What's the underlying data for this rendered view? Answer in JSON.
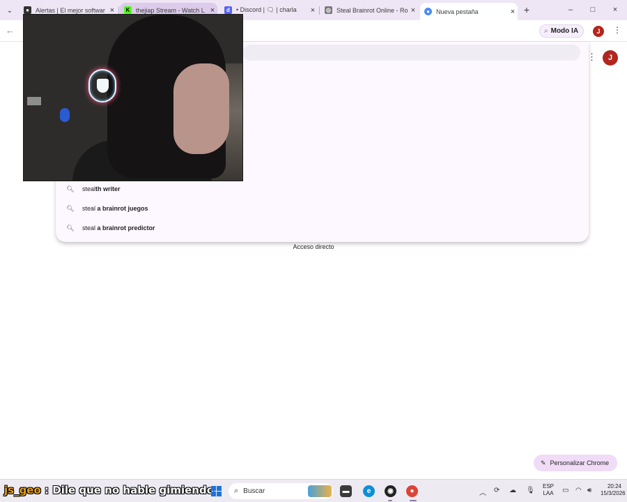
{
  "colors": {
    "accent": "#7b5ca3",
    "tab_strip_bg": "#efe6f5",
    "dropdown_bg": "#fdf7ff",
    "avatar": "#b3261e",
    "chat_username": "#e2a11d"
  },
  "browser": {
    "tabs": [
      {
        "favicon": "obs-icon",
        "title": "Alertas | El mejor softwar",
        "close": "×"
      },
      {
        "favicon": "kick-icon",
        "title": "thejiap Stream - Watch L",
        "close": "×"
      },
      {
        "favicon": "discord-icon",
        "title": "• Discord | 🗨 | charla",
        "close": "×"
      },
      {
        "favicon": "globe-icon",
        "title": "Steal Brainrot Online - Ro",
        "close": "×"
      },
      {
        "favicon": "chrome-icon",
        "title": "Nueva pestaña",
        "close": "×"
      }
    ],
    "new_tab_symbol": "+",
    "window_controls": {
      "minimize": "–",
      "maximize": "□",
      "close": "×"
    },
    "toolbar": {
      "back": "←",
      "ai_mode_label": "Modo IA",
      "avatar_initial": "J",
      "menu": "⋮"
    }
  },
  "omnibox": {
    "avatar_initial": "J",
    "suggestions": [
      {
        "typed": "steal",
        "completion": "th writer"
      },
      {
        "typed": "steal ",
        "completion": "a brainrot juegos"
      },
      {
        "typed": "steal ",
        "completion": "a brainrot predictor"
      }
    ]
  },
  "shortcut_label": "Acceso directo",
  "customize_label": "Personalizar Chrome",
  "taskbar": {
    "chat_user": "js_geo",
    "chat_sep": " : ",
    "chat_message": "Dile que no hable gimiendo",
    "search_placeholder": "Buscar",
    "lang_line1": "ESP",
    "lang_line2": "LAA",
    "time": "20:24",
    "date": "15/3/2026"
  }
}
